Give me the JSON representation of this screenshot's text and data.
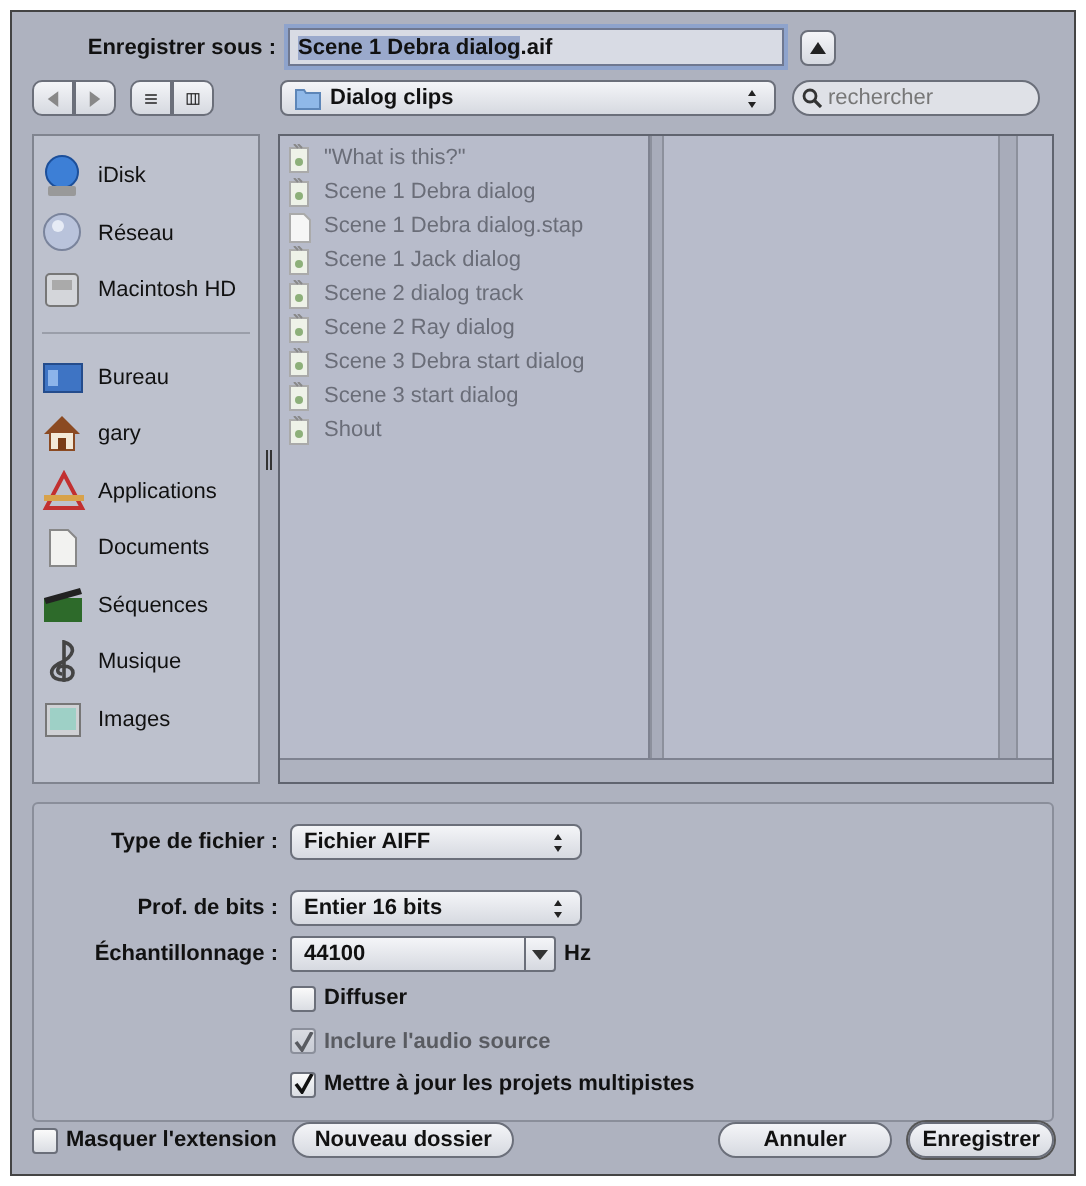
{
  "save_as": {
    "label": "Enregistrer sous :",
    "filename_selected": "Scene 1 Debra dialog",
    "filename_rest": ".aif"
  },
  "location": {
    "folder": "Dialog clips"
  },
  "search": {
    "placeholder": "rechercher"
  },
  "sidebar": {
    "devices": [
      {
        "label": "iDisk"
      },
      {
        "label": "Réseau"
      },
      {
        "label": "Macintosh HD"
      }
    ],
    "places": [
      {
        "label": "Bureau"
      },
      {
        "label": "gary"
      },
      {
        "label": "Applications"
      },
      {
        "label": "Documents"
      },
      {
        "label": "Séquences"
      },
      {
        "label": "Musique"
      },
      {
        "label": "Images"
      }
    ]
  },
  "files": [
    {
      "name": "\"What is this?\"",
      "kind": "audio"
    },
    {
      "name": "Scene 1 Debra dialog",
      "kind": "audio"
    },
    {
      "name": "Scene 1 Debra dialog.stap",
      "kind": "document"
    },
    {
      "name": "Scene 1 Jack dialog",
      "kind": "audio"
    },
    {
      "name": "Scene 2 dialog track",
      "kind": "audio"
    },
    {
      "name": "Scene 2 Ray dialog",
      "kind": "audio"
    },
    {
      "name": "Scene 3 Debra start dialog",
      "kind": "audio"
    },
    {
      "name": "Scene 3 start dialog",
      "kind": "audio"
    },
    {
      "name": "Shout",
      "kind": "audio"
    }
  ],
  "options": [
    {
      "kind": "popup",
      "label": "Type de fichier :",
      "value": "Fichier AIFF"
    },
    {
      "kind": "popup",
      "label": "Prof. de bits :",
      "value": "Entier 16 bits"
    },
    {
      "kind": "combo",
      "label": "Échantillonnage :",
      "value": "44100",
      "unit": "Hz"
    },
    {
      "kind": "checkbox",
      "label": "Diffuser",
      "checked": false,
      "disabled": false
    },
    {
      "kind": "checkbox",
      "label": "Inclure l'audio source",
      "checked": true,
      "disabled": true
    },
    {
      "kind": "checkbox",
      "label": "Mettre à jour les projets multipistes",
      "checked": true,
      "disabled": false
    }
  ],
  "hide_extension": {
    "label": "Masquer l'extension",
    "checked": false
  },
  "buttons": [
    {
      "label": "Nouveau dossier",
      "kind": "left"
    },
    {
      "label": "Annuler",
      "kind": "right"
    },
    {
      "label": "Enregistrer",
      "kind": "default"
    }
  ]
}
